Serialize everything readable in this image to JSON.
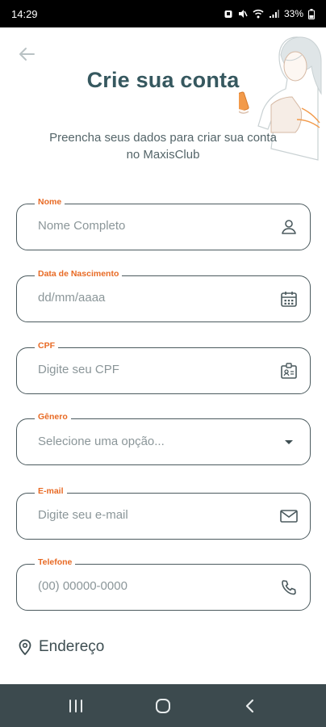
{
  "status_bar": {
    "time": "14:29",
    "battery": "33%"
  },
  "header": {
    "title": "Crie sua conta",
    "subtitle": "Preencha seus dados para criar sua conta no MaxisClub"
  },
  "form": {
    "name": {
      "label": "Nome",
      "placeholder": "Nome Completo",
      "icon": "person-icon"
    },
    "birthdate": {
      "label": "Data de Nascimento",
      "placeholder": "dd/mm/aaaa",
      "icon": "calendar-icon"
    },
    "cpf": {
      "label": "CPF",
      "placeholder": "Digite seu CPF",
      "icon": "id-card-icon"
    },
    "gender": {
      "label": "Gênero",
      "value": "Selecione uma opção...",
      "icon": "caret-down-icon"
    },
    "email": {
      "label": "E-mail",
      "placeholder": "Digite seu e-mail",
      "icon": "envelope-icon"
    },
    "phone": {
      "label": "Telefone",
      "placeholder": "(00) 00000-0000",
      "icon": "phone-icon"
    }
  },
  "address_section": {
    "title": "Endereço",
    "icon": "location-pin-icon"
  },
  "colors": {
    "accent": "#e86a24",
    "primary": "#36585f",
    "nav_bar": "#3c4a4e"
  }
}
